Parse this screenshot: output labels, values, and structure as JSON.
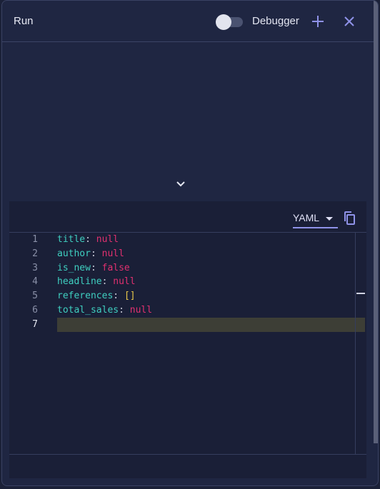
{
  "header": {
    "title": "Run",
    "debugger_label": "Debugger",
    "debugger_enabled": false
  },
  "editor": {
    "format": "YAML",
    "lines": [
      {
        "num": "1",
        "key": "title",
        "value": "null",
        "type": "null"
      },
      {
        "num": "2",
        "key": "author",
        "value": "null",
        "type": "null"
      },
      {
        "num": "3",
        "key": "is_new",
        "value": "false",
        "type": "bool"
      },
      {
        "num": "4",
        "key": "headline",
        "value": "null",
        "type": "null"
      },
      {
        "num": "5",
        "key": "references",
        "value": "[]",
        "type": "array"
      },
      {
        "num": "6",
        "key": "total_sales",
        "value": "null",
        "type": "null"
      },
      {
        "num": "7",
        "key": "",
        "value": "",
        "type": "empty"
      }
    ],
    "current_line": 7
  },
  "icons": {
    "add": "plus-icon",
    "close": "close-icon",
    "collapse": "chevron-down-icon",
    "copy": "copy-icon",
    "dropdown": "caret-down-icon"
  },
  "colors": {
    "background": "#1f2642",
    "accent": "#8f92e8",
    "key": "#3fcfc0",
    "null": "#e0306f",
    "bracket": "#e7c64a"
  }
}
